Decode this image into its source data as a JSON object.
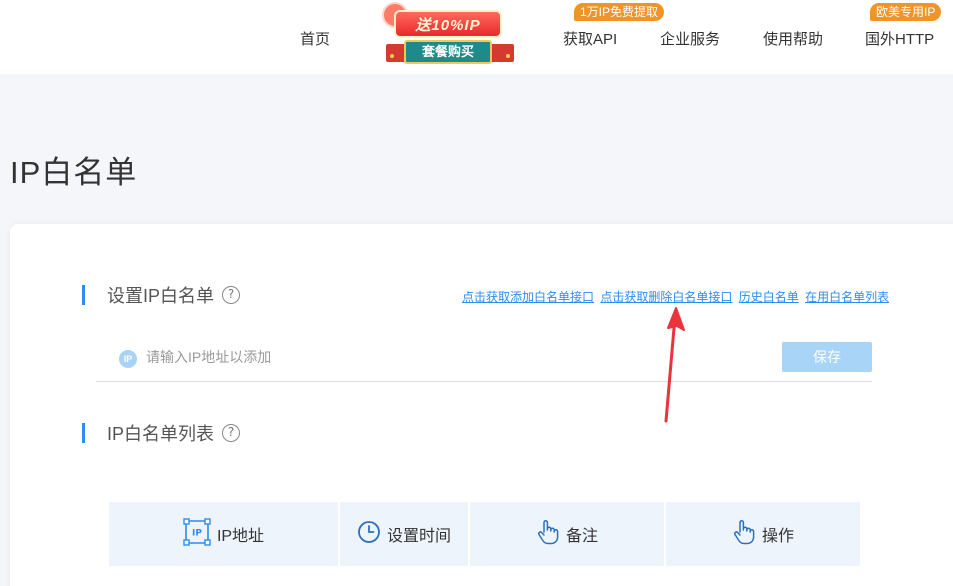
{
  "nav": {
    "home": "首页",
    "get_api": "获取API",
    "get_api_badge": "1万IP免费提取",
    "enterprise": "企业服务",
    "help": "使用帮助",
    "overseas": "国外HTTP",
    "overseas_badge": "欧美专用IP",
    "promo_top": "送10%IP",
    "promo_bottom": "套餐购买"
  },
  "page": {
    "title": "IP白名单"
  },
  "set_section": {
    "title": "设置IP白名单",
    "help": "?",
    "links": [
      "点击获取添加白名单接口",
      "点击获取删除白名单接口",
      "历史白名单",
      "在用白名单列表"
    ],
    "input_badge": "IP",
    "input_placeholder": "请输入IP地址以添加",
    "save_label": "保存"
  },
  "list_section": {
    "title": "IP白名单列表",
    "help": "?",
    "columns": [
      "IP地址",
      "设置时间",
      "备注",
      "操作"
    ],
    "ip_icon_text": "IP"
  },
  "colors": {
    "accent": "#2d8cf0",
    "badge": "#f0942a",
    "save_button": "#a8d4f8",
    "table_header": "#eef4fb",
    "annotation_arrow": "#e8343a"
  }
}
